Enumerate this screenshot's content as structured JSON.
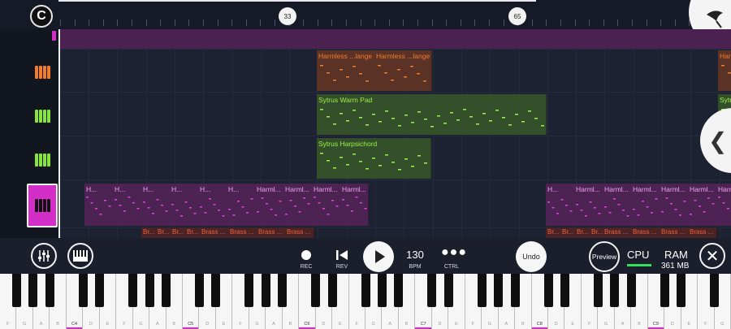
{
  "timeline": {
    "logo_glyph": "C",
    "markers": [
      "33",
      "65"
    ]
  },
  "tracks": [
    {
      "id": "brass-top",
      "color": "#d32fc8"
    },
    {
      "id": "harmless",
      "color": "#f07c2c",
      "clips": [
        {
          "label": "Harmless ...lange",
          "color": "#f07c2c"
        },
        {
          "label": "Harmless ...lange",
          "color": "#f07c2c"
        },
        {
          "label": "Harmless ...lange",
          "color": "#f07c2c"
        }
      ]
    },
    {
      "id": "sytrus-warm",
      "color": "#86e43a",
      "clips": [
        {
          "label": "Sytrus Warm Pad",
          "color": "#9ef04a"
        },
        {
          "label": "Sytrus Warm Pad",
          "color": "#9ef04a"
        }
      ]
    },
    {
      "id": "sytrus-harp",
      "color": "#86e43a",
      "clips": [
        {
          "label": "Sytrus Harpsichord",
          "color": "#9ef04a"
        }
      ]
    },
    {
      "id": "harmless-lead",
      "color": "#d32fc8",
      "clips": [
        {
          "label": "H..."
        },
        {
          "label": "H..."
        },
        {
          "label": "H..."
        },
        {
          "label": "H..."
        },
        {
          "label": "H..."
        },
        {
          "label": "H..."
        },
        {
          "label": "Harml..."
        },
        {
          "label": "Harml..."
        },
        {
          "label": "Harml..."
        },
        {
          "label": "Harml..."
        },
        {
          "label": "H..."
        },
        {
          "label": "Harml..."
        },
        {
          "label": "Harml..."
        },
        {
          "label": "Harml..."
        },
        {
          "label": "Harml..."
        },
        {
          "label": "Harml..."
        },
        {
          "label": "Harml..."
        }
      ]
    },
    {
      "id": "brass-bottom",
      "color": "#e2482c",
      "clips": [
        {
          "label": "Br..."
        },
        {
          "label": "Br..."
        },
        {
          "label": "Br..."
        },
        {
          "label": "Br..."
        },
        {
          "label": "Brass ..."
        },
        {
          "label": "Brass ..."
        },
        {
          "label": "Brass ..."
        },
        {
          "label": "Brass ..."
        },
        {
          "label": "Br..."
        },
        {
          "label": "Br..."
        },
        {
          "label": "Br..."
        },
        {
          "label": "Br..."
        },
        {
          "label": "Brass ..."
        },
        {
          "label": "Brass ..."
        },
        {
          "label": "Brass ..."
        },
        {
          "label": "Brass ..."
        }
      ]
    }
  ],
  "transport": {
    "rec_label": "REC",
    "rev_label": "REV",
    "bpm_value": "130",
    "bpm_label": "BPM",
    "ctrl_label": "CTRL",
    "undo_label": "Undo",
    "preview_label": "Preview",
    "cpu_label": "CPU",
    "cpu_color": "#2ee05a",
    "ram_label": "RAM",
    "ram_value": "361 MB"
  },
  "keyboard": {
    "white_notes": [
      "F",
      "G",
      "A",
      "B",
      "C4",
      "D",
      "E",
      "F",
      "G",
      "A",
      "B",
      "C5",
      "D",
      "E",
      "F",
      "G",
      "A",
      "B",
      "C6",
      "D",
      "E",
      "F",
      "G",
      "A",
      "B",
      "C7",
      "D",
      "E",
      "F",
      "G",
      "A",
      "B",
      "C8",
      "D",
      "E",
      "F",
      "G",
      "A",
      "B",
      "C9",
      "D",
      "E",
      "F",
      "G"
    ],
    "accent": "#d32fc8"
  }
}
